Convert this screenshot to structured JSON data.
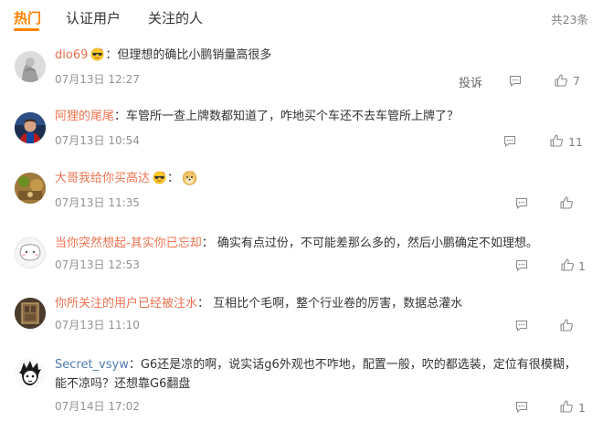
{
  "tabs": [
    {
      "label": "热门",
      "active": true
    },
    {
      "label": "认证用户",
      "active": false
    },
    {
      "label": "关注的人",
      "active": false
    }
  ],
  "total_label": "共23条",
  "colors": {
    "accent": "#ff8200",
    "username": "#eb7350",
    "link_username": "#507daf",
    "meta": "#939393"
  },
  "comments": [
    {
      "user": "dio69",
      "badge": "sunglasses-emoji",
      "text": "但理想的确比小鹏销量高很多",
      "time": "07月13日 12:27",
      "report_label": "投诉",
      "likes": "7"
    },
    {
      "user": "阿狸的尾尾",
      "badge": "",
      "text": "车管所一查上牌数都知道了，咋地买个车还不去车管所上牌了？",
      "time": "07月13日 10:54",
      "likes": "11"
    },
    {
      "user": "大哥我给你买高达",
      "badge": "sunglasses-emoji",
      "text": "",
      "time": "07月13日 11:35",
      "likes": "",
      "extra_badge": "doge-emoji"
    },
    {
      "user": "当你突然想起-其实你已忘却",
      "badge": "",
      "text": "确实有点过份，不可能差那么多的，然后小鹏确定不如理想。",
      "time": "07月13日 12:53",
      "likes": "1"
    },
    {
      "user": "你所关注的用户已经被注水",
      "badge": "",
      "text": "互相比个毛啊，整个行业卷的厉害，数据总灌水",
      "time": "07月13日 11:10",
      "likes": ""
    },
    {
      "user": "Secret_vsyw",
      "badge": "",
      "text": "G6还是凉的啊，说实话g6外观也不咋地，配置一般，吹的都选装，定位有很模糊，能不凉吗？还想靠G6翻盘",
      "time": "07月14日 17:02",
      "likes": "1"
    }
  ]
}
